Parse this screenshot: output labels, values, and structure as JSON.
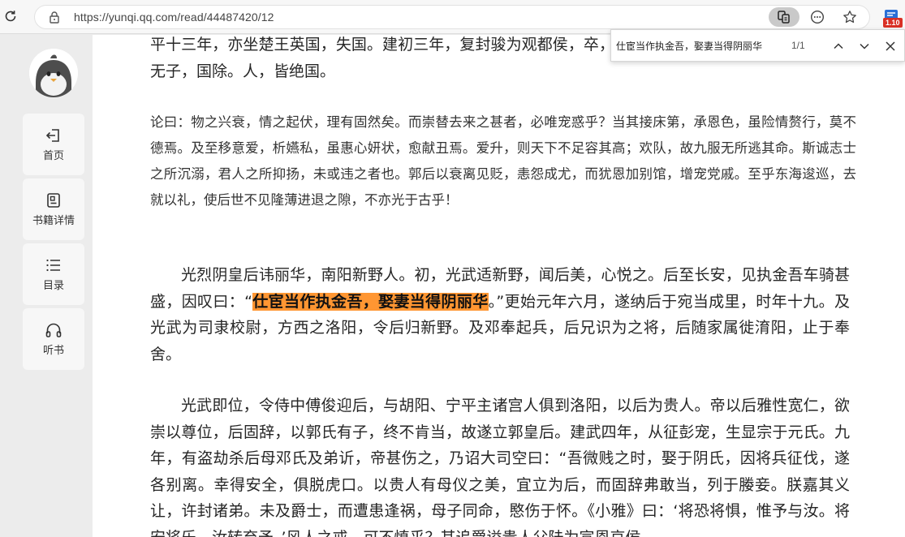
{
  "browser": {
    "url": "https://yunqi.qq.com/read/44487420/12",
    "extension_badge": "1.10",
    "icons": {
      "reload": "reload-icon",
      "lock": "lock-icon",
      "read_mode": "read-aloud-icon",
      "more": "more-icon",
      "favorite": "star-icon"
    }
  },
  "find_bar": {
    "query": "仕宦当作执金吾，娶妻当得阴丽华",
    "count": "1/1"
  },
  "sidebar": {
    "items": [
      {
        "label": "首页",
        "icon": "exit-icon"
      },
      {
        "label": "书籍详情",
        "icon": "book-detail-icon"
      },
      {
        "label": "目录",
        "icon": "list-icon"
      },
      {
        "label": "听书",
        "icon": "headphones-icon"
      }
    ]
  },
  "article": {
    "para_top": "平十三年，亦坐楚王英国，失国。建初三年，复封骏为观都侯，卒，无子，国除。人，皆绝国。",
    "para_lun": "论曰：物之兴衰，情之起伏，理有固然矣。而崇替去来之甚者，必唯宠惑乎？当其接床第，承恩色，虽险情赘行，莫不德焉。及至移意爱，析嬿私，虽惠心妍状，愈献丑焉。爱升，则天下不足容其高；欢队，故九服无所逃其命。斯诚志士之所沉溺，君人之所抑扬，未或违之者也。郭后以衰离见贬，恚怨成尤，而犹恩加别馆，增宠党戚。至乎东海逡巡，去就以礼，使后世不见隆薄进退之隙，不亦光于古乎！",
    "para_wife_before": "光烈阴皇后讳丽华，南阳新野人。初，光武适新野，闻后美，心悦之。后至长安，见执金吾车骑甚盛，因叹曰：“",
    "para_wife_highlight": "仕宦当作执金吾，娶妻当得阴丽华",
    "para_wife_after": "。”更始元年六月，遂纳后于宛当成里，时年十九。及光武为司隶校尉，方西之洛阳，令后归新野。及邓奉起兵，后兄识为之将，后随家属徙淯阳，止于奉舍。",
    "para_emperor": "光武即位，令侍中傅俊迎后，与胡阳、宁平主诸宫人俱到洛阳，以后为贵人。帝以后雅性宽仁，欲崇以尊位，后固辞，以郭氏有子，终不肯当，故遂立郭皇后。建武四年，从征彭宠，生显宗于元氏。九年，有盗劫杀后母邓氏及弟䜣，帝甚伤之，乃诏大司空曰：“吾微贱之时，娶于阴氏，因将兵征伐，遂各别离。幸得安全，俱脱虎口。以贵人有母仪之美，宜立为后，而固辞弗敢当，列于媵妾。朕嘉其义让，许封诸弟。未及爵士，而遭患逢祸，母子同命，愍伤于怀。《小雅》曰：‘将恐将惧，惟予与汝。将安将乐，汝转弃予。’风人之戒，可不慎乎？其追爵谥贵人父陆为宣恩哀侯"
  },
  "colors": {
    "highlight": "#ff9632",
    "page_bg": "#ffffff",
    "sidebar_bg": "#ececec",
    "badge": "#d93025"
  }
}
